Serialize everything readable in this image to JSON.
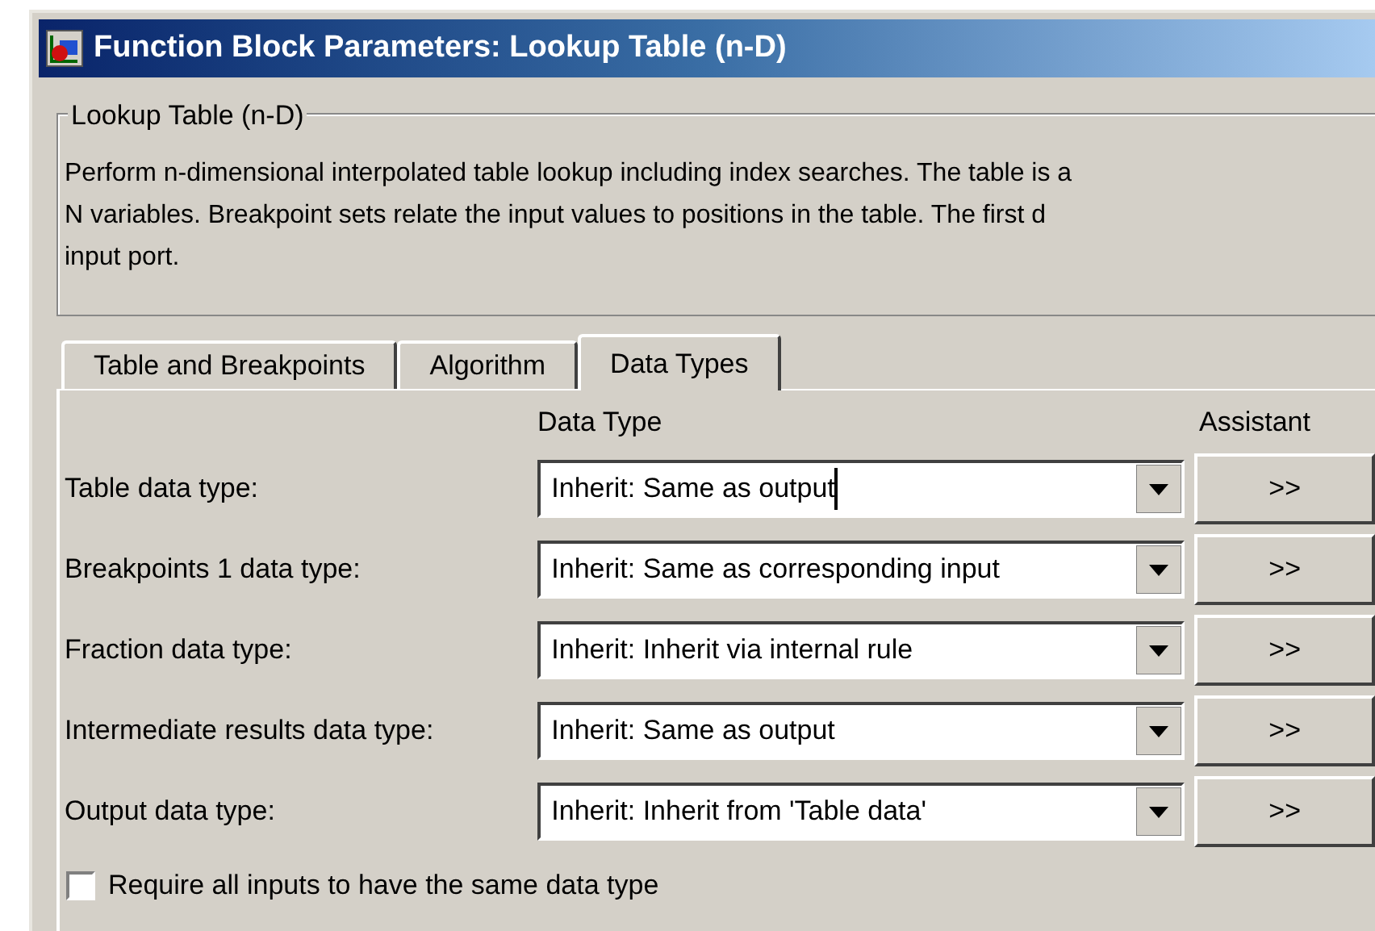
{
  "window": {
    "title": "Function Block Parameters: Lookup Table (n-D)"
  },
  "group": {
    "title": "Lookup Table (n-D)",
    "description_lines": [
      "Perform n-dimensional interpolated table lookup including index searches. The table is a",
      "N variables. Breakpoint sets relate the input values to positions in the table. The first d",
      "input port."
    ]
  },
  "tabs": [
    {
      "label": "Table and Breakpoints",
      "selected": false
    },
    {
      "label": "Algorithm",
      "selected": false
    },
    {
      "label": "Data Types",
      "selected": true
    }
  ],
  "columns": {
    "data_type": "Data Type",
    "assistant": "Assistant"
  },
  "rows": [
    {
      "label": "Table data type:",
      "value": "Inherit: Same as output",
      "focused": true,
      "button": ">>"
    },
    {
      "label": "Breakpoints 1 data type:",
      "value": "Inherit: Same as corresponding input",
      "focused": false,
      "button": ">>"
    },
    {
      "label": "Fraction data type:",
      "value": "Inherit: Inherit via internal rule",
      "focused": false,
      "button": ">>"
    },
    {
      "label": "Intermediate results data type:",
      "value": "Inherit: Same as output",
      "focused": false,
      "button": ">>"
    },
    {
      "label": "Output data type:",
      "value": "Inherit: Inherit from 'Table data'",
      "focused": false,
      "button": ">>"
    }
  ],
  "checkbox": {
    "label": "Require all inputs to have the same data type",
    "checked": false
  }
}
